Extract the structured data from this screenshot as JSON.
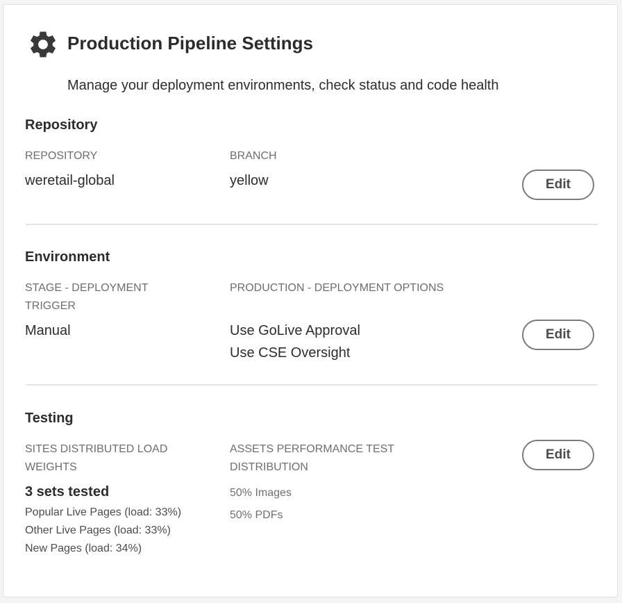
{
  "header": {
    "title": "Production Pipeline Settings",
    "subtitle": "Manage your deployment environments, check status and code health",
    "icon": "gear-icon"
  },
  "repository": {
    "section_title": "Repository",
    "repo_label": "REPOSITORY",
    "repo_value": "weretail-global",
    "branch_label": "BRANCH",
    "branch_value": "yellow",
    "edit_label": "Edit"
  },
  "environment": {
    "section_title": "Environment",
    "stage_label_line1": "STAGE - DEPLOYMENT",
    "stage_label_line2": "TRIGGER",
    "stage_value": "Manual",
    "prod_label": "PRODUCTION - DEPLOYMENT OPTIONS",
    "prod_options": [
      "Use GoLive Approval",
      "Use CSE Oversight"
    ],
    "edit_label": "Edit"
  },
  "testing": {
    "section_title": "Testing",
    "sites_label_line1": "SITES DISTRIBUTED LOAD",
    "sites_label_line2": "WEIGHTS",
    "sets_tested": "3 sets tested",
    "sets": [
      "Popular Live Pages (load: 33%)",
      "Other Live Pages (load: 33%)",
      "New Pages (load: 34%)"
    ],
    "assets_label_line1": "ASSETS PERFORMANCE TEST",
    "assets_label_line2": "DISTRIBUTION",
    "assets": [
      "50% Images",
      "50% PDFs"
    ],
    "edit_label": "Edit"
  },
  "colors": {
    "text": "#2c2c2c",
    "label": "#6e6e6e",
    "button_border": "#7a7a7a",
    "divider": "#e4e4e4"
  }
}
